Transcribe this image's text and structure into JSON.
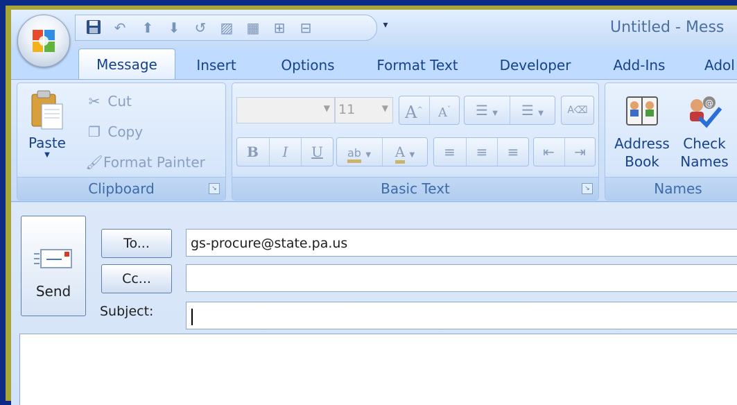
{
  "window": {
    "title": "Untitled - Mess"
  },
  "tabs": [
    {
      "label": "Message",
      "active": true
    },
    {
      "label": "Insert"
    },
    {
      "label": "Options"
    },
    {
      "label": "Format Text"
    },
    {
      "label": "Developer"
    },
    {
      "label": "Add-Ins"
    },
    {
      "label": "Adol"
    }
  ],
  "clipboard": {
    "group_label": "Clipboard",
    "paste": "Paste",
    "cut": "Cut",
    "copy": "Copy",
    "format_painter": "Format Painter"
  },
  "basic_text": {
    "group_label": "Basic Text",
    "font_name": "",
    "font_size": "11",
    "bold": "B",
    "italic": "I",
    "underline": "U",
    "grow": "A",
    "shrink": "A",
    "font_color": "A",
    "highlight": "ab"
  },
  "names": {
    "group_label": "Names",
    "address_book_1": "Address",
    "address_book_2": "Book",
    "check_names_1": "Check",
    "check_names_2": "Names"
  },
  "message": {
    "send": "Send",
    "to_button": "To...",
    "cc_button": "Cc...",
    "subject_label": "Subject:",
    "to_value": "gs-procure@state.pa.us",
    "cc_value": "",
    "subject_value": ""
  },
  "colors": {
    "accent": "#15428b",
    "ribbon": "#c7dcf6",
    "desktop": "#0c2a86",
    "outer_border": "#a9a637"
  }
}
